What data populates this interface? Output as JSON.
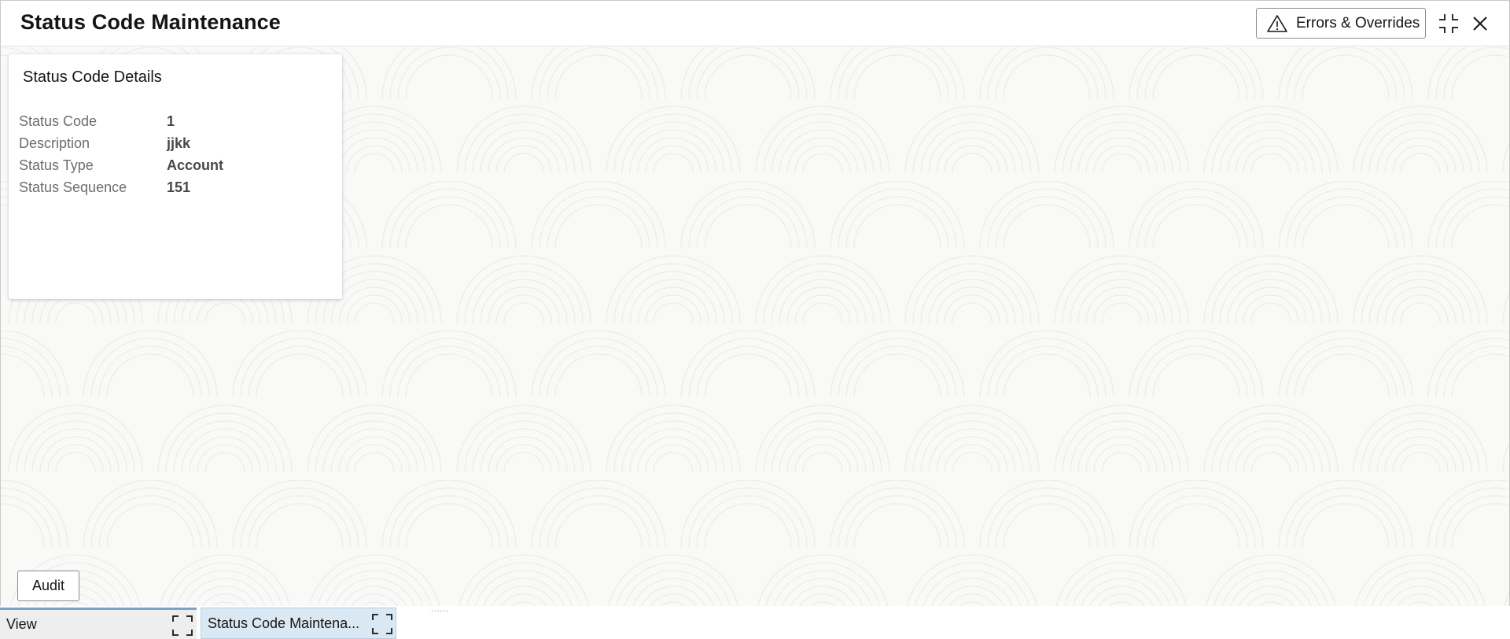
{
  "header": {
    "title": "Status Code Maintenance",
    "errors_button_label": "Errors & Overrides",
    "icons": [
      "warning-icon",
      "collapse-icon",
      "close-icon"
    ]
  },
  "card": {
    "title": "Status Code Details",
    "fields": [
      {
        "label": "Status Code",
        "value": "1"
      },
      {
        "label": "Description",
        "value": "jjkk"
      },
      {
        "label": "Status Type",
        "value": "Account"
      },
      {
        "label": "Status Sequence",
        "value": "151"
      }
    ]
  },
  "footer": {
    "audit_label": "Audit"
  },
  "taskbar": {
    "tabs": [
      {
        "label": "View",
        "icon": "expand-icon"
      },
      {
        "label": "Status Code Maintena...",
        "icon": "expand-icon"
      }
    ]
  }
}
